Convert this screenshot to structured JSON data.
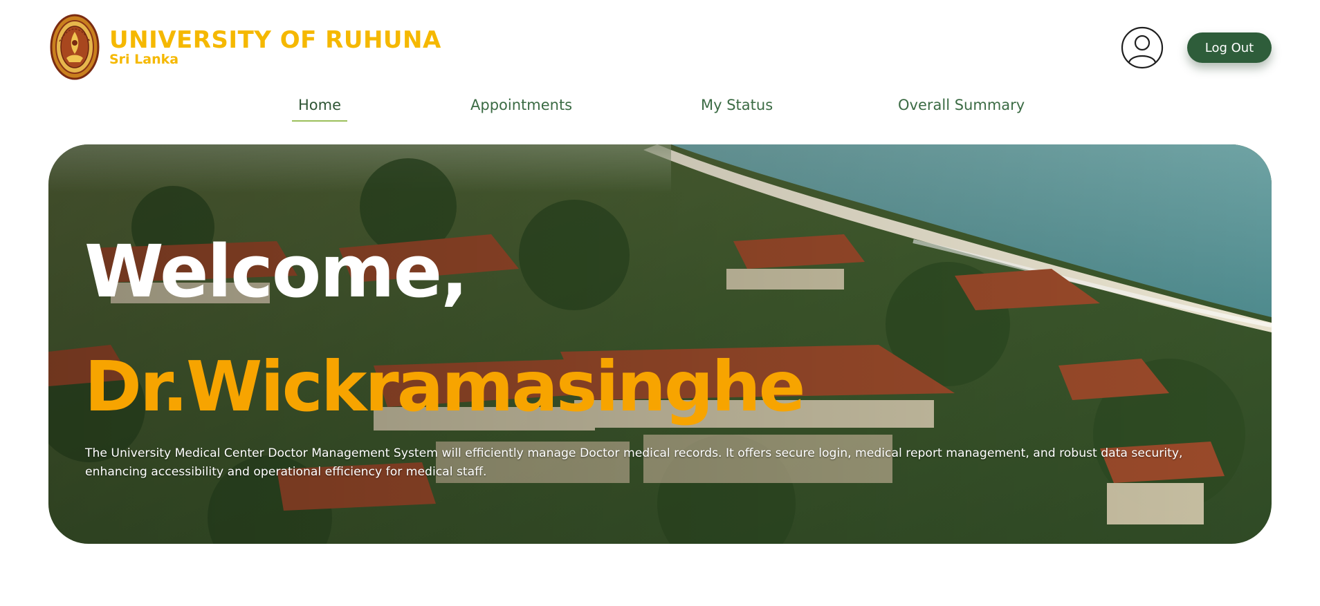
{
  "header": {
    "university_name": "UNIVERSITY OF RUHUNA",
    "country": "Sri Lanka",
    "logo_icon": "university-seal-icon",
    "profile_icon": "user-circle-icon",
    "logout_label": "Log Out"
  },
  "nav": {
    "items": [
      {
        "label": "Home",
        "active": true
      },
      {
        "label": "Appointments",
        "active": false
      },
      {
        "label": "My Status",
        "active": false
      },
      {
        "label": "Overall Summary",
        "active": false
      }
    ]
  },
  "hero": {
    "greeting": "Welcome,",
    "doctor_name": "Dr.Wickramasinghe",
    "description": "The University Medical Center Doctor Management System will efficiently manage Doctor medical records. It offers secure login, medical report management, and robust data security, enhancing accessibility and operational efficiency for medical staff.",
    "background": "aerial-campus-coastline-image"
  },
  "colors": {
    "brand_yellow": "#f5b800",
    "primary_green": "#2e5d3a",
    "nav_text": "#3b6b44",
    "active_underline": "#9bbf5a",
    "name_orange": "#f7a400"
  }
}
